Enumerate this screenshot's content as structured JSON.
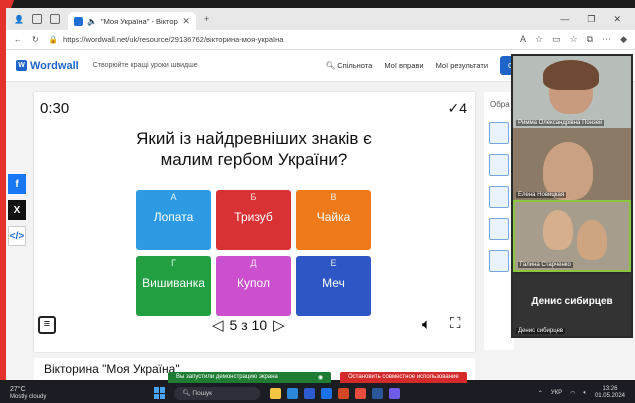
{
  "browser": {
    "tab_title": "\"Моя Україна\" - Вікторина",
    "url": "https://wordwall.net/uk/resource/29136762/вікторина-моя-україна"
  },
  "header": {
    "logo": "Wordwall",
    "slogan": "Створюйте кращі уроки швидше",
    "nav": [
      "Спільнота",
      "Мої вправи",
      "Мої результати"
    ],
    "create_label": "Створи"
  },
  "game": {
    "timer": "0:30",
    "score": "4",
    "score_icon": "check-icon",
    "question": "Який із найдревніших знаків є малим гербом України?",
    "answers": [
      {
        "letter": "А",
        "text": "Лопата",
        "color": "#2d9be4"
      },
      {
        "letter": "Б",
        "text": "Тризуб",
        "color": "#d93234"
      },
      {
        "letter": "В",
        "text": "Чайка",
        "color": "#ef7a1a"
      },
      {
        "letter": "Г",
        "text": "Вишиванка",
        "color": "#22a041"
      },
      {
        "letter": "Д",
        "text": "Купол",
        "color": "#cc4fce"
      },
      {
        "letter": "Е",
        "text": "Меч",
        "color": "#2f56c5"
      }
    ],
    "pager": "5 з 10"
  },
  "activity_title": "Вікторина \"Моя Україна\"",
  "right_panel": {
    "label": "Обра"
  },
  "share": {
    "facebook": "f",
    "x": "X",
    "embed": "</>"
  },
  "video": {
    "tiles": [
      {
        "name": "Римма Олександрівна Понзей"
      },
      {
        "name": "Елена Новицкая"
      },
      {
        "name": "Галина Старченко"
      }
    ],
    "big_name": "Денис сибирцев",
    "big_caption": "Денис сибирцев"
  },
  "sharing": {
    "notice": "Вы запустили демонстрацию экрана",
    "stop": "Остановить совместное использование"
  },
  "taskbar": {
    "temp": "27°C",
    "weather": "Mostly cloudy",
    "search": "Пошук",
    "lang": "УКР",
    "time": "13:26",
    "date": "01.05.2024"
  }
}
